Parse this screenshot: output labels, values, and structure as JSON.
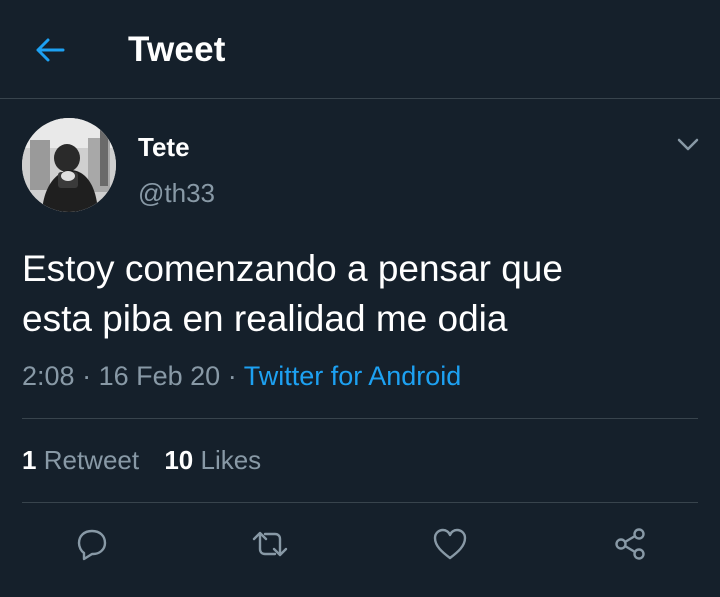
{
  "header": {
    "title": "Tweet",
    "back_icon": "arrow-left-icon"
  },
  "author": {
    "display_name": "Tete",
    "handle": "@th33"
  },
  "tweet": {
    "text_line1": "Estoy comenzando a pensar que",
    "text_line2": "esta piba en realidad me odia",
    "time": "2:08",
    "separator": "·",
    "date": "16 Feb 20",
    "source": "Twitter for Android"
  },
  "stats": {
    "retweets_count": "1",
    "retweets_label": "Retweet",
    "likes_count": "10",
    "likes_label": "Likes"
  },
  "actions": [
    "reply-icon",
    "retweet-icon",
    "like-icon",
    "share-icon"
  ],
  "colors": {
    "background": "#15202b",
    "accent": "#1da1f2",
    "muted": "#8899a6",
    "divider": "#38444d"
  }
}
